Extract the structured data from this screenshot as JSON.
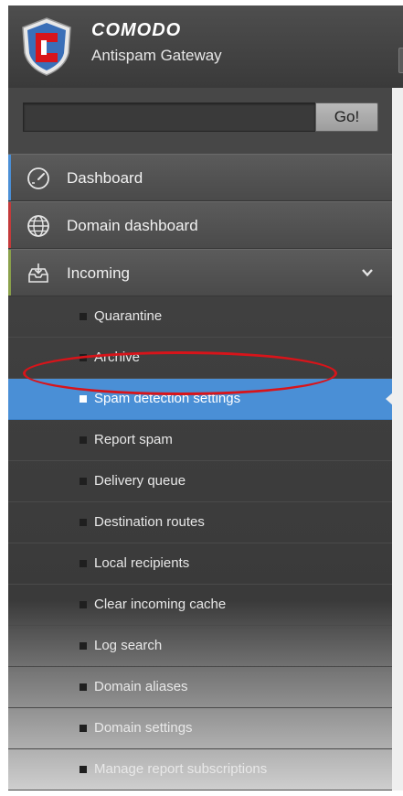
{
  "brand": {
    "name": "COMODO",
    "product": "Antispam Gateway",
    "logo_icon": "comodo-shield-logo"
  },
  "search": {
    "value": "",
    "placeholder": "",
    "button_label": "Go!"
  },
  "nav": {
    "dashboard": {
      "label": "Dashboard",
      "icon": "gauge-icon",
      "accent": "#4a8fd6"
    },
    "domain_dashboard": {
      "label": "Domain dashboard",
      "icon": "globe-icon",
      "accent": "#c43a3a"
    },
    "incoming": {
      "label": "Incoming",
      "icon": "inbox-icon",
      "accent": "#8aa04a",
      "expanded": true
    }
  },
  "incoming_items": [
    {
      "label": "Quarantine",
      "active": false
    },
    {
      "label": "Archive",
      "active": false
    },
    {
      "label": "Spam detection settings",
      "active": true
    },
    {
      "label": "Report spam",
      "active": false
    },
    {
      "label": "Delivery queue",
      "active": false
    },
    {
      "label": "Destination routes",
      "active": false
    },
    {
      "label": "Local recipients",
      "active": false
    },
    {
      "label": "Clear incoming cache",
      "active": false
    },
    {
      "label": "Log search",
      "active": false
    },
    {
      "label": "Domain aliases",
      "active": false
    },
    {
      "label": "Domain settings",
      "active": false
    },
    {
      "label": "Manage report subscriptions",
      "active": false
    }
  ],
  "colors": {
    "active_highlight": "#4a8fd6",
    "annotation": "#d8141a"
  }
}
